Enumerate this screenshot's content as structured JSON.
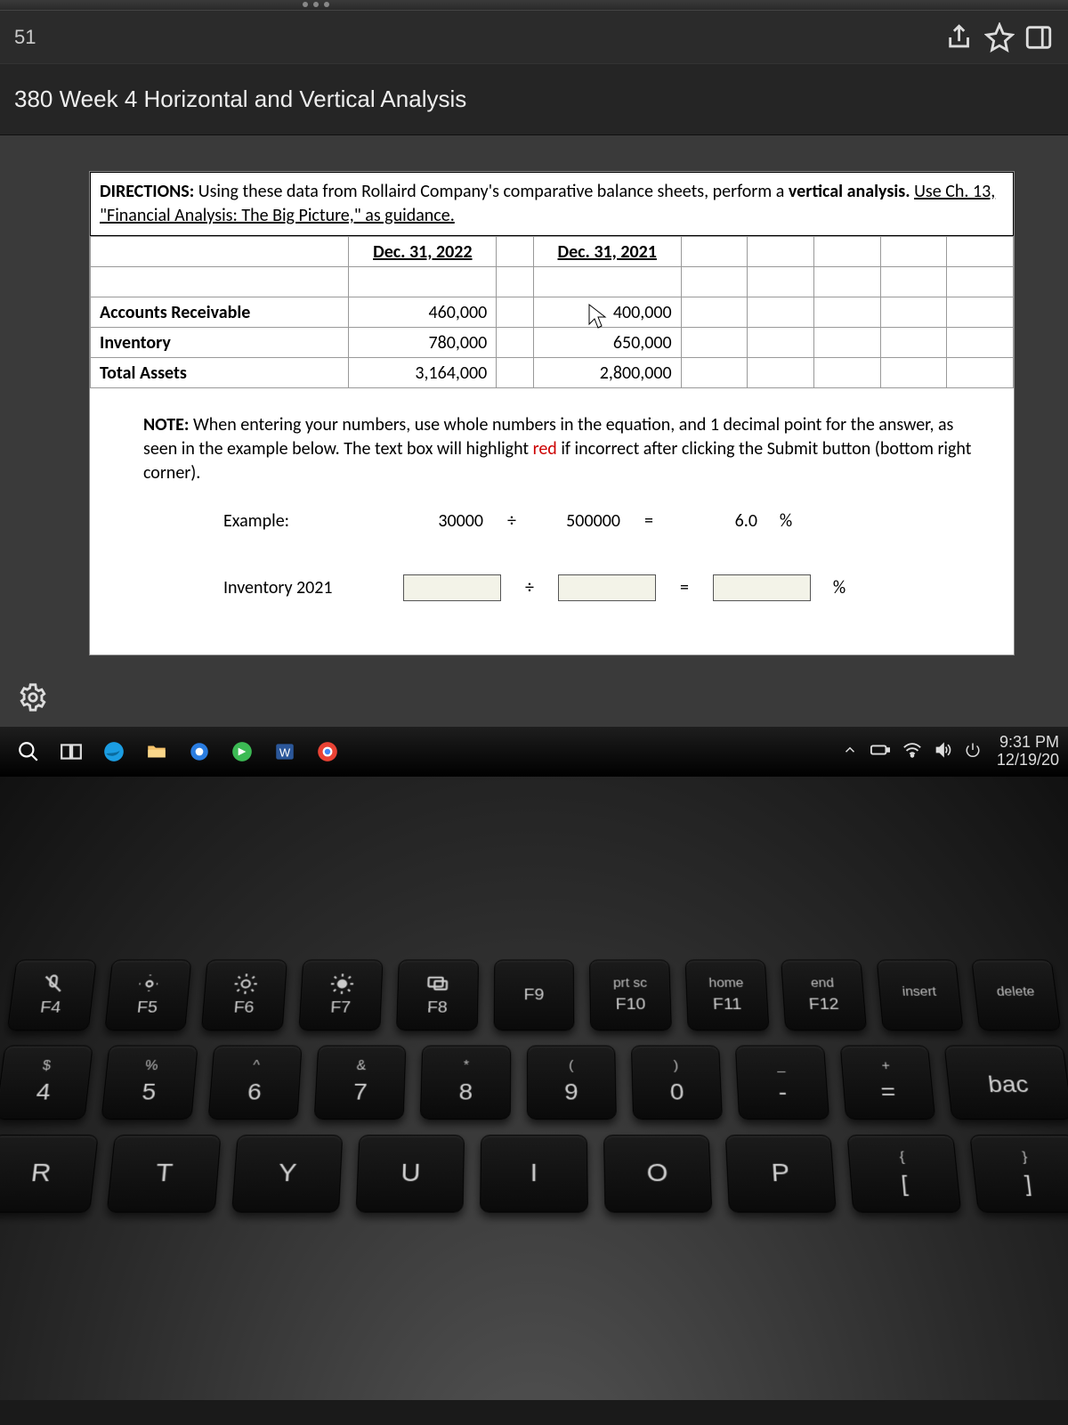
{
  "browser": {
    "address_fragment": "51"
  },
  "page": {
    "title": "380 Week 4 Horizontal and Vertical Analysis"
  },
  "directions": {
    "label": "DIRECTIONS:",
    "text1": "Using these data from Rollaird Company's comparative balance sheets, perform a ",
    "bold1": "vertical analysis.",
    "text2": " Use Ch. 13, \"Financial Analysis: The Big Picture,\" as guidance."
  },
  "table": {
    "headers": [
      "Dec. 31, 2022",
      "Dec. 31, 2021"
    ],
    "rows": [
      {
        "label": "Accounts Receivable",
        "v2022": "460,000",
        "v2021": "400,000"
      },
      {
        "label": "Inventory",
        "v2022": "780,000",
        "v2021": "650,000"
      },
      {
        "label": "Total Assets",
        "v2022": "3,164,000",
        "v2021": "2,800,000"
      }
    ]
  },
  "note": {
    "label": "NOTE:",
    "text1": "When entering your numbers, use whole numbers in the equation, and 1 decimal point for the answer, as seen in the example below. The text box will highlight ",
    "red": "red",
    "text2": " if incorrect after clicking the Submit button (bottom right corner)."
  },
  "example": {
    "label": "Example:",
    "num": "30000",
    "div": "÷",
    "den": "500000",
    "eq": "=",
    "ans": "6.0",
    "pct": "%"
  },
  "input_row": {
    "label": "Inventory 2021",
    "div": "÷",
    "eq": "=",
    "pct": "%"
  },
  "taskbar": {
    "time": "9:31 PM",
    "date": "12/19/20"
  },
  "keyboard": {
    "frow": [
      {
        "icon": "mic-off",
        "fn": "F4"
      },
      {
        "icon": "sun-low",
        "fn": "F5"
      },
      {
        "icon": "sun-high",
        "fn": "F6"
      },
      {
        "icon": "bright",
        "fn": "F7"
      },
      {
        "icon": "project",
        "fn": "F8"
      },
      {
        "top": "",
        "fn": "F9"
      },
      {
        "top": "prt sc",
        "fn": "F10"
      },
      {
        "top": "home",
        "fn": "F11"
      },
      {
        "top": "end",
        "fn": "F12"
      },
      {
        "top": "insert",
        "fn": ""
      },
      {
        "top": "delete",
        "fn": ""
      }
    ],
    "numrow": [
      {
        "top": "$",
        "bot": "4"
      },
      {
        "top": "%",
        "bot": "5"
      },
      {
        "top": "^",
        "bot": "6"
      },
      {
        "top": "&",
        "bot": "7"
      },
      {
        "top": "*",
        "bot": "8"
      },
      {
        "top": "(",
        "bot": "9"
      },
      {
        "top": ")",
        "bot": "0"
      },
      {
        "top": "_",
        "bot": "-"
      },
      {
        "top": "+",
        "bot": "="
      },
      {
        "top": "",
        "bot": "bac"
      }
    ],
    "qrow": [
      "R",
      "T",
      "Y",
      "U",
      "I",
      "O",
      "P"
    ],
    "qsym": [
      {
        "top": "{",
        "bot": "["
      },
      {
        "top": "}",
        "bot": "]"
      }
    ]
  }
}
